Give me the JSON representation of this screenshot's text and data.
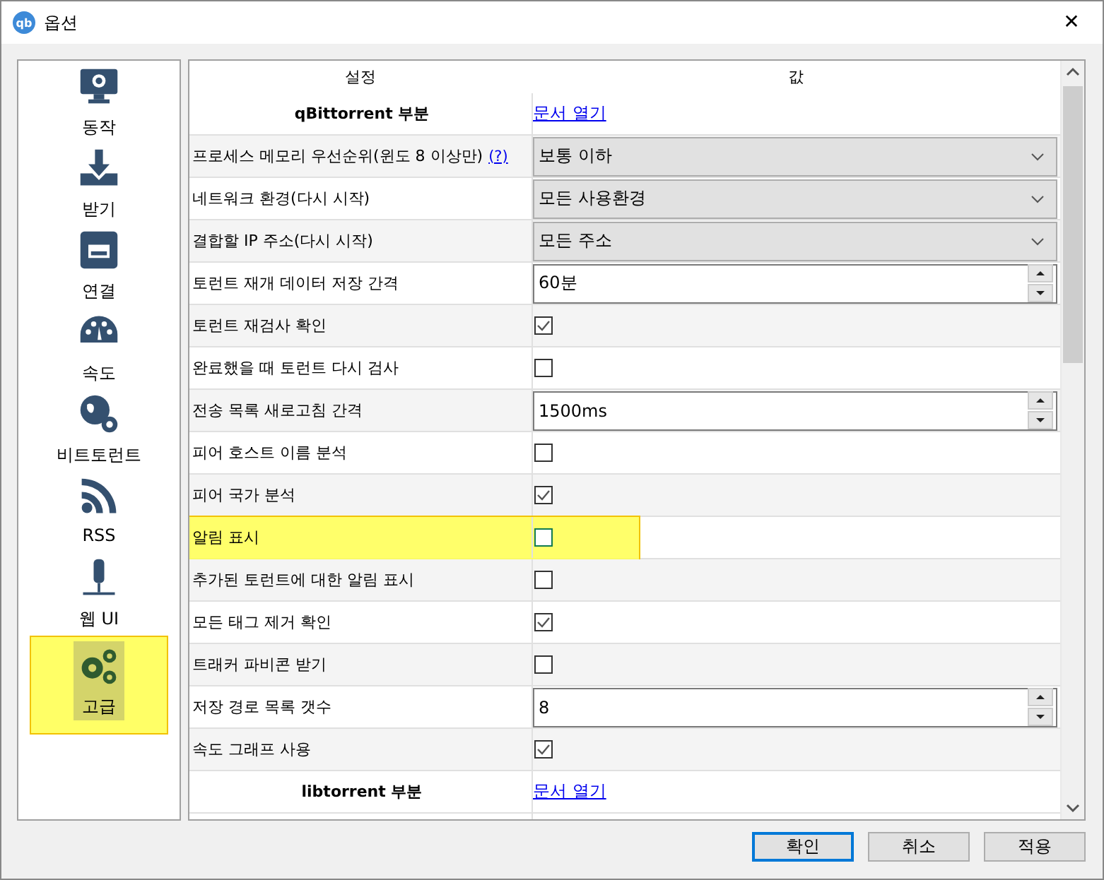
{
  "window": {
    "title": "옵션",
    "app_icon": "qb",
    "close": "✕"
  },
  "sidebar": {
    "items": [
      {
        "label": "동작",
        "selected": false,
        "highlighted": false
      },
      {
        "label": "받기",
        "selected": false,
        "highlighted": false
      },
      {
        "label": "연결",
        "selected": false,
        "highlighted": false
      },
      {
        "label": "속도",
        "selected": false,
        "highlighted": false
      },
      {
        "label": "비트토런트",
        "selected": false,
        "highlighted": false
      },
      {
        "label": "RSS",
        "selected": false,
        "highlighted": false
      },
      {
        "label": "웹 UI",
        "selected": false,
        "highlighted": false
      },
      {
        "label": "고급",
        "selected": true,
        "highlighted": true
      }
    ]
  },
  "table": {
    "columns": [
      "설정",
      "값"
    ],
    "rows": [
      {
        "kind": "section",
        "label": "qBittorrent 부분",
        "link": "문서 열기",
        "highlighted": false
      },
      {
        "kind": "combo",
        "label": "프로세스 메모리 우선순위(윈도 8 이상만)",
        "help": "(?)",
        "value": "보통 이하",
        "highlighted": false
      },
      {
        "kind": "combo",
        "label": "네트워크 환경(다시 시작)",
        "value": "모든 사용환경",
        "highlighted": false
      },
      {
        "kind": "combo",
        "label": "결합할 IP 주소(다시 시작)",
        "value": "모든 주소",
        "highlighted": false
      },
      {
        "kind": "spin",
        "label": "토런트 재개 데이터 저장 간격",
        "value": "60분",
        "highlighted": false
      },
      {
        "kind": "check",
        "label": "토런트 재검사 확인",
        "checked": true,
        "highlighted": false
      },
      {
        "kind": "check",
        "label": "완료했을 때 토런트 다시 검사",
        "checked": false,
        "highlighted": false
      },
      {
        "kind": "spin",
        "label": "전송 목록 새로고침 간격",
        "value": "1500ms",
        "highlighted": false
      },
      {
        "kind": "check",
        "label": "피어 호스트 이름 분석",
        "checked": false,
        "highlighted": false
      },
      {
        "kind": "check",
        "label": "피어 국가 분석",
        "checked": true,
        "highlighted": false
      },
      {
        "kind": "check",
        "label": "알림 표시",
        "checked": false,
        "highlighted": true
      },
      {
        "kind": "check",
        "label": "추가된 토런트에 대한 알림 표시",
        "checked": false,
        "highlighted": false
      },
      {
        "kind": "check",
        "label": "모든 태그 제거 확인",
        "checked": true,
        "highlighted": false
      },
      {
        "kind": "check",
        "label": "트래커 파비콘 받기",
        "checked": false,
        "highlighted": false
      },
      {
        "kind": "spin",
        "label": "저장 경로 목록 갯수",
        "value": "8",
        "highlighted": false
      },
      {
        "kind": "check",
        "label": "속도 그래프 사용",
        "checked": true,
        "highlighted": false
      },
      {
        "kind": "section",
        "label": "libtorrent 부분",
        "link": "문서 열기",
        "highlighted": false
      }
    ]
  },
  "buttons": [
    {
      "label": "확인",
      "default": true
    },
    {
      "label": "취소",
      "default": false
    },
    {
      "label": "적용",
      "default": false
    }
  ]
}
